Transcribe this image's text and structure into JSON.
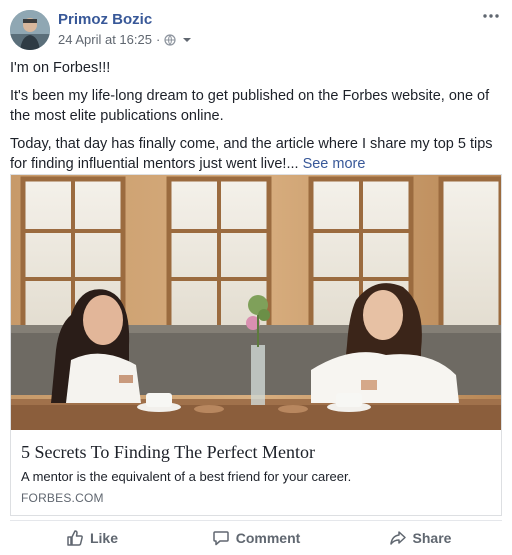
{
  "post": {
    "author": "Primoz Bozic",
    "timestamp": "24 April at 16:25",
    "separator": "·",
    "privacy_icon": "globe-icon",
    "paragraphs": [
      "I'm on Forbes!!!",
      "It's been my life-long dream to get published on the Forbes website, one of the most elite publications online.",
      "Today, that day has finally come, and the article where I share my top 5 tips for finding influential mentors just went live!... "
    ],
    "see_more": "See more"
  },
  "link_preview": {
    "title": "5 Secrets To Finding The Perfect Mentor",
    "description": "A mentor is the equivalent of a best friend for your career.",
    "domain": "FORBES.COM"
  },
  "actions": {
    "like": "Like",
    "comment": "Comment",
    "share": "Share"
  },
  "colors": {
    "link": "#385898",
    "secondary_text": "#606770",
    "body_text": "#1d2129",
    "border": "#dddfe2"
  }
}
